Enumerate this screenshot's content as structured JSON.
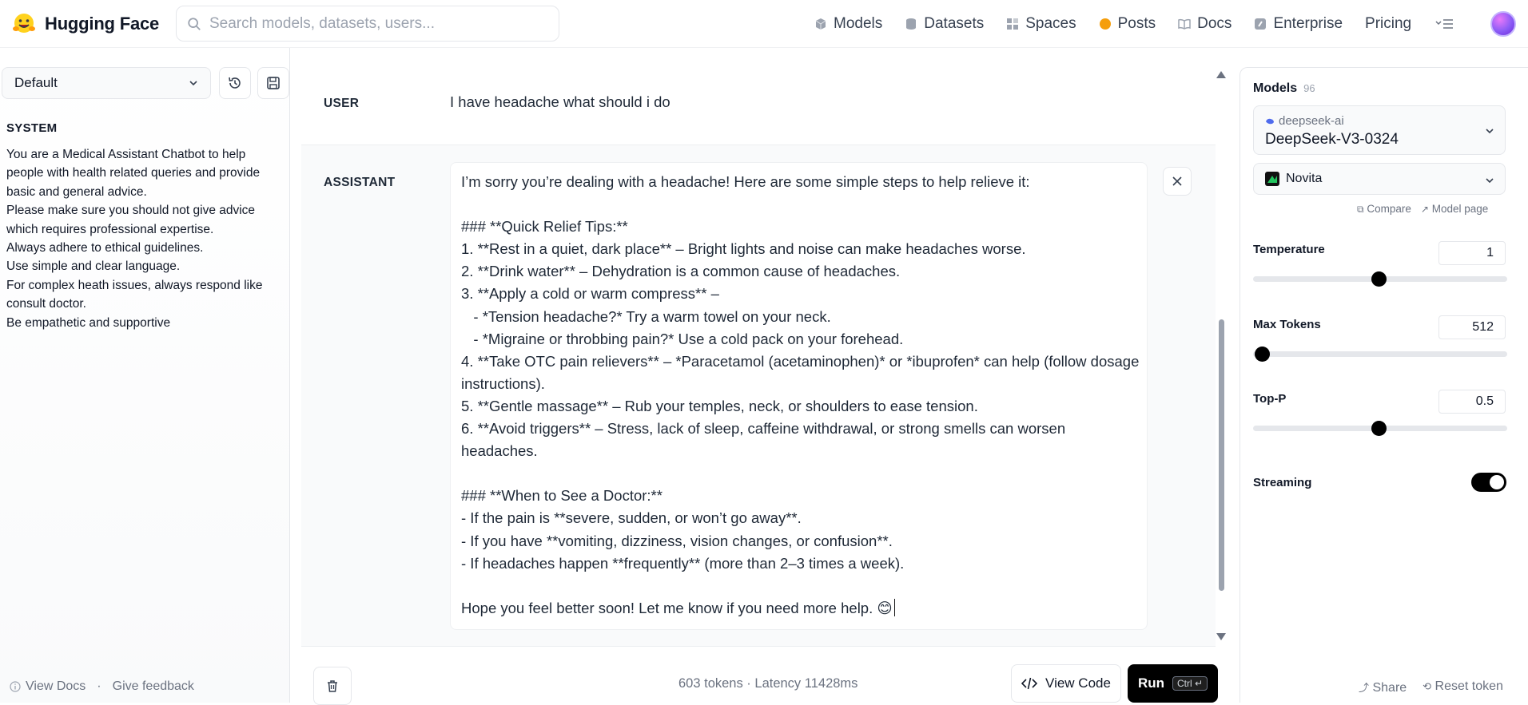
{
  "header": {
    "brand": "Hugging Face",
    "search_placeholder": "Search models, datasets, users...",
    "nav": [
      {
        "label": "Models",
        "icon": "cube-icon"
      },
      {
        "label": "Datasets",
        "icon": "database-icon"
      },
      {
        "label": "Spaces",
        "icon": "grid-icon"
      },
      {
        "label": "Posts",
        "icon": "chat-bubble-icon"
      },
      {
        "label": "Docs",
        "icon": "book-icon"
      },
      {
        "label": "Enterprise",
        "icon": "enterprise-icon"
      },
      {
        "label": "Pricing",
        "icon": ""
      }
    ]
  },
  "left": {
    "preset": "Default",
    "system_label": "SYSTEM",
    "system_text": "You are a Medical Assistant Chatbot to help people with health related queries and provide basic and general advice.\nPlease make sure you should not give advice which requires professional expertise.\nAlways adhere to ethical guidelines.\nUse simple and clear language.\nFor complex heath issues, always respond like consult doctor.\nBe empathetic and supportive",
    "view_docs": "View Docs",
    "feedback": "Give feedback"
  },
  "chat": {
    "user_role": "USER",
    "user_text": "I have headache what should i do",
    "assistant_role": "ASSISTANT",
    "assistant_text": "I’m sorry you’re dealing with a headache! Here are some simple steps to help relieve it:\n\n### **Quick Relief Tips:**\n1. **Rest in a quiet, dark place** – Bright lights and noise can make headaches worse.\n2. **Drink water** – Dehydration is a common cause of headaches.\n3. **Apply a cold or warm compress** –\n   - *Tension headache?* Try a warm towel on your neck.\n   - *Migraine or throbbing pain?* Use a cold pack on your forehead.\n4. **Take OTC pain relievers** – *Paracetamol (acetaminophen)* or *ibuprofen* can help (follow dosage instructions).\n5. **Gentle massage** – Rub your temples, neck, or shoulders to ease tension.\n6. **Avoid triggers** – Stress, lack of sleep, caffeine withdrawal, or strong smells can worsen headaches.\n\n### **When to See a Doctor:**\n- If the pain is **severe, sudden, or won’t go away**.\n- If you have **vomiting, dizziness, vision changes, or confusion**.\n- If headaches happen **frequently** (more than 2–3 times a week).\n\nHope you feel better soon! Let me know if you need more help. 😊"
  },
  "bottom": {
    "stats": "603 tokens · Latency 11428ms",
    "view_code": "View Code",
    "run": "Run",
    "shortcut": "Ctrl ↵"
  },
  "right": {
    "models_label": "Models",
    "models_count": "96",
    "model_org": "deepseek-ai",
    "model_name": "DeepSeek-V3-0324",
    "provider": "Novita",
    "compare": "Compare",
    "model_page": "Model page",
    "temperature_label": "Temperature",
    "temperature": "1",
    "max_tokens_label": "Max Tokens",
    "max_tokens": "512",
    "top_p_label": "Top-P",
    "top_p": "0.5",
    "streaming_label": "Streaming",
    "streaming_on": true,
    "share": "Share",
    "reset_token": "Reset token"
  },
  "colors": {
    "accent": "#000000",
    "brand_yellow": "#FFD21E",
    "novita_green": "#22c55e"
  }
}
